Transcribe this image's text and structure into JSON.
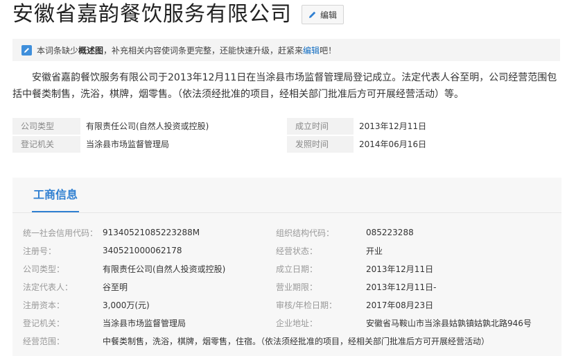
{
  "header": {
    "title": "安徽省嘉韵餐饮服务有限公司",
    "edit_label": "编辑"
  },
  "notice": {
    "prefix": "本词条缺少",
    "bold": "概述图",
    "middle": "，补充相关内容使词条更完整，还能快速升级，赶紧来",
    "link": "编辑",
    "suffix": "吧！"
  },
  "summary": "安徽省嘉韵餐饮服务有限公司于2013年12月11日在当涂县市场监督管理局登记成立。法定代表人谷至明，公司经营范围包括中餐类制售，洗浴，棋牌，烟零售。（依法须经批准的项目，经相关部门批准后方可开展经营活动）等。",
  "basic_info": [
    {
      "k1": "公司类型",
      "v1": "有限责任公司(自然人投资或控股)",
      "k2": "成立时间",
      "v2": "2013年12月11日"
    },
    {
      "k1": "登记机关",
      "v1": "当涂县市场监督管理局",
      "k2": "发照时间",
      "v2": "2014年06月16日"
    }
  ],
  "business": {
    "tab_label": "工商信息",
    "rows": [
      {
        "k1": "统一社会信用代码：",
        "v1": "91340521085223288M",
        "k2": "组织结构代码：",
        "v2": "085223288"
      },
      {
        "k1": "注册号：",
        "v1": "340521000062178",
        "k2": "经营状态：",
        "v2": "开业"
      },
      {
        "k1": "公司类型：",
        "v1": "有限责任公司(自然人投资或控股)",
        "k2": "成立日期：",
        "v2": "2013年12月11日"
      },
      {
        "k1": "法定代表人：",
        "v1": "谷至明",
        "k2": "营业期限：",
        "v2": "2013年12月11日-"
      },
      {
        "k1": "注册资本：",
        "v1": "3,000万(元)",
        "k2": "审核/年检日期：",
        "v2": "2017年08月23日"
      },
      {
        "k1": "登记机关：",
        "v1": "当涂县市场监督管理局",
        "k2": "企业地址：",
        "v2": "安徽省马鞍山市当涂县姑孰镇姑孰北路946号"
      }
    ],
    "scope_label": "经营范围：",
    "scope_value": "中餐类制售，洗浴，棋牌，烟零售，住宿。（依法须经批准的项目，经相关部门批准后方可开展经营活动）"
  }
}
